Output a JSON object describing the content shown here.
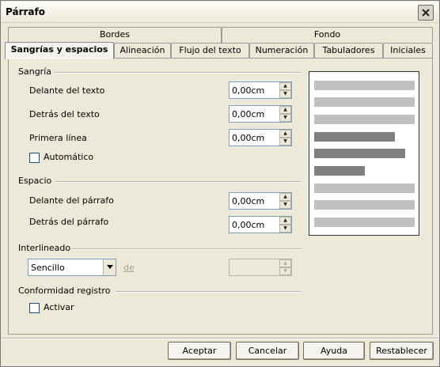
{
  "window": {
    "title": "Párrafo"
  },
  "tabs_top": [
    {
      "label": "Bordes"
    },
    {
      "label": "Fondo"
    }
  ],
  "tabs_bottom": [
    {
      "label": "Sangrías y espacios",
      "active": true
    },
    {
      "label": "Alineación"
    },
    {
      "label": "Flujo del texto"
    },
    {
      "label": "Numeración"
    },
    {
      "label": "Tabuladores"
    },
    {
      "label": "Iniciales"
    }
  ],
  "sangria": {
    "title": "Sangría",
    "delante": {
      "label": "Delante del texto",
      "value": "0,00cm"
    },
    "detras": {
      "label": "Detrás del texto",
      "value": "0,00cm"
    },
    "primera": {
      "label": "Primera línea",
      "value": "0,00cm"
    },
    "automatico": {
      "label": "Automático",
      "checked": false
    }
  },
  "espacio": {
    "title": "Espacio",
    "delante": {
      "label": "Delante del párrafo",
      "value": "0,00cm"
    },
    "detras": {
      "label": "Detrás del párrafo",
      "value": "0,00cm"
    }
  },
  "interlineado": {
    "title": "Interlineado",
    "selected": "Sencillo",
    "de_label": "de",
    "value": ""
  },
  "conformidad": {
    "title": "Conformidad registro",
    "activar": {
      "label": "Activar",
      "checked": false
    }
  },
  "buttons": {
    "accept": "Aceptar",
    "cancel": "Cancelar",
    "help": "Ayuda",
    "reset": "Restablecer"
  },
  "colors": {
    "dialog_bg": "#ece9d8",
    "preview_light": "#c0c0c0",
    "preview_dark": "#808080"
  }
}
